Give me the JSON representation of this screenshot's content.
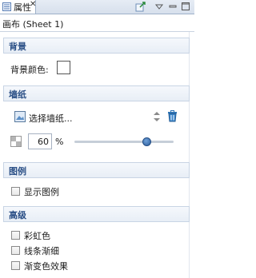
{
  "tab": {
    "label": "属性",
    "close": "✕"
  },
  "title": "画布 (Sheet 1)",
  "sections": {
    "background": {
      "header": "背景",
      "color_label": "背景颜色:",
      "color_value": "#ffffff"
    },
    "wallpaper": {
      "header": "墙纸",
      "select_label": "选择墙纸...",
      "opacity_value": "60",
      "opacity_unit": "%",
      "opacity_level": 0.6
    },
    "legend": {
      "header": "图例",
      "show_legend_label": "显示图例",
      "show_legend_checked": false
    },
    "advanced": {
      "header": "高级",
      "rainbow_label": "彩虹色",
      "taper_label": "线条渐细",
      "gradient_label": "渐变色效果"
    }
  },
  "colors": {
    "section_header_text": "#2a4f86",
    "accent": "#2c5e9c"
  }
}
